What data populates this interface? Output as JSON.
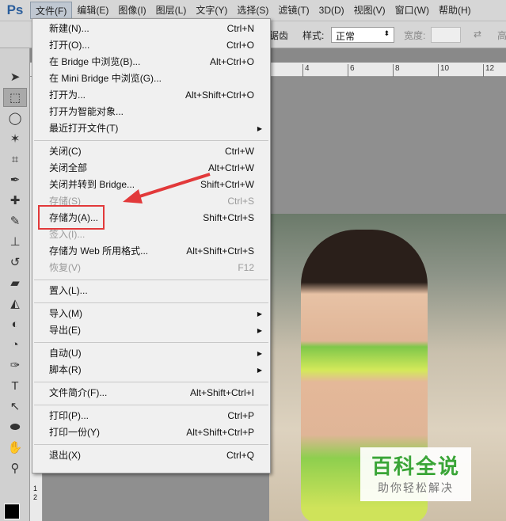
{
  "app": {
    "logo": "Ps"
  },
  "menubar": [
    "文件(F)",
    "编辑(E)",
    "图像(I)",
    "图层(L)",
    "文字(Y)",
    "选择(S)",
    "滤镜(T)",
    "3D(D)",
    "视图(V)",
    "窗口(W)",
    "帮助(H)"
  ],
  "options": {
    "antialias_fragment": "锯齿",
    "style_label": "样式:",
    "style_value": "正常",
    "width_label": "宽度:",
    "height_fragment": "高"
  },
  "ruler": {
    "top": [
      "4",
      "6",
      "8",
      "10",
      "12"
    ],
    "left": [
      "1",
      "2"
    ]
  },
  "file_menu": {
    "groups": [
      [
        {
          "label": "新建(N)...",
          "shortcut": "Ctrl+N"
        },
        {
          "label": "打开(O)...",
          "shortcut": "Ctrl+O"
        },
        {
          "label": "在 Bridge 中浏览(B)...",
          "shortcut": "Alt+Ctrl+O"
        },
        {
          "label": "在 Mini Bridge 中浏览(G)...",
          "shortcut": ""
        },
        {
          "label": "打开为...",
          "shortcut": "Alt+Shift+Ctrl+O"
        },
        {
          "label": "打开为智能对象...",
          "shortcut": ""
        },
        {
          "label": "最近打开文件(T)",
          "shortcut": "",
          "submenu": true
        }
      ],
      [
        {
          "label": "关闭(C)",
          "shortcut": "Ctrl+W"
        },
        {
          "label": "关闭全部",
          "shortcut": "Alt+Ctrl+W"
        },
        {
          "label": "关闭并转到 Bridge...",
          "shortcut": "Shift+Ctrl+W"
        },
        {
          "label": "存储(S)",
          "shortcut": "Ctrl+S",
          "disabled": true
        },
        {
          "label": "存储为(A)...",
          "shortcut": "Shift+Ctrl+S"
        },
        {
          "label": "签入(I)...",
          "shortcut": "",
          "disabled": true
        },
        {
          "label": "存储为 Web 所用格式...",
          "shortcut": "Alt+Shift+Ctrl+S"
        },
        {
          "label": "恢复(V)",
          "shortcut": "F12",
          "disabled": true
        }
      ],
      [
        {
          "label": "置入(L)...",
          "shortcut": ""
        }
      ],
      [
        {
          "label": "导入(M)",
          "shortcut": "",
          "submenu": true
        },
        {
          "label": "导出(E)",
          "shortcut": "",
          "submenu": true
        }
      ],
      [
        {
          "label": "自动(U)",
          "shortcut": "",
          "submenu": true
        },
        {
          "label": "脚本(R)",
          "shortcut": "",
          "submenu": true
        }
      ],
      [
        {
          "label": "文件简介(F)...",
          "shortcut": "Alt+Shift+Ctrl+I"
        }
      ],
      [
        {
          "label": "打印(P)...",
          "shortcut": "Ctrl+P"
        },
        {
          "label": "打印一份(Y)",
          "shortcut": "Alt+Shift+Ctrl+P"
        }
      ],
      [
        {
          "label": "退出(X)",
          "shortcut": "Ctrl+Q"
        }
      ]
    ]
  },
  "tools": [
    {
      "icon": "move-icon",
      "glyph": "➤"
    },
    {
      "icon": "marquee-icon",
      "glyph": "⬚"
    },
    {
      "icon": "lasso-icon",
      "glyph": "◯"
    },
    {
      "icon": "magic-wand-icon",
      "glyph": "✶"
    },
    {
      "icon": "crop-icon",
      "glyph": "⌗"
    },
    {
      "icon": "eyedropper-icon",
      "glyph": "✒"
    },
    {
      "icon": "healing-brush-icon",
      "glyph": "✚"
    },
    {
      "icon": "brush-icon",
      "glyph": "✎"
    },
    {
      "icon": "stamp-icon",
      "glyph": "⊥"
    },
    {
      "icon": "history-brush-icon",
      "glyph": "↺"
    },
    {
      "icon": "eraser-icon",
      "glyph": "▰"
    },
    {
      "icon": "paint-bucket-icon",
      "glyph": "◭"
    },
    {
      "icon": "blur-icon",
      "glyph": "◐"
    },
    {
      "icon": "dodge-icon",
      "glyph": "◔"
    },
    {
      "icon": "pen-icon",
      "glyph": "✑"
    },
    {
      "icon": "type-icon",
      "glyph": "T"
    },
    {
      "icon": "path-select-icon",
      "glyph": "↖"
    },
    {
      "icon": "ellipse-icon",
      "glyph": "⬬"
    },
    {
      "icon": "hand-icon",
      "glyph": "✋"
    },
    {
      "icon": "zoom-icon",
      "glyph": "⚲"
    }
  ],
  "watermark": {
    "title": "百科全说",
    "subtitle": "助你轻松解决"
  },
  "colors": {
    "highlight": "#e2393a",
    "accent": "#3aa537"
  }
}
